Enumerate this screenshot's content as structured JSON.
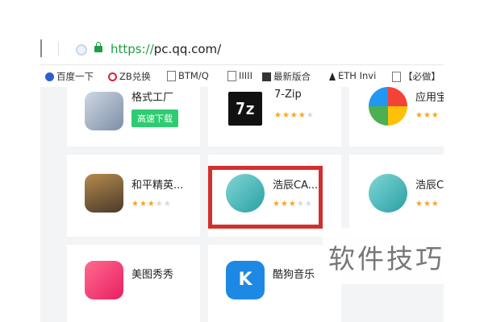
{
  "browser": {
    "separator_glyph": "|",
    "url_prefix": "https://",
    "url_host": "pc.qq.com",
    "url_path": "/"
  },
  "bookmarks": [
    {
      "label": "百度一下",
      "icon": "baidu-paw-icon"
    },
    {
      "label": "ZB兑换",
      "icon": "zb-icon"
    },
    {
      "label": "BTM/Q",
      "icon": "page-icon"
    },
    {
      "label": "IIIII",
      "icon": "page-icon"
    },
    {
      "label": "最新版合",
      "icon": "news-icon"
    },
    {
      "label": "ETH Invi",
      "icon": "eth-icon"
    },
    {
      "label": "【必做】",
      "icon": "page-icon"
    }
  ],
  "apps": {
    "format_factory": {
      "name": "格式工厂",
      "button": "高速下载"
    },
    "seven_zip": {
      "name": "7-Zip",
      "icon_text": "7z",
      "stars": 4
    },
    "app_store": {
      "name": "应用宝",
      "stars": 3
    },
    "peace_elite": {
      "name": "和平精英...",
      "stars": 3
    },
    "haochen_cad_1": {
      "name": "浩辰CA...",
      "stars": 3
    },
    "haochen_cad_2": {
      "name": "浩辰C",
      "stars": 3
    },
    "meitu": {
      "name": "美图秀秀"
    },
    "kugou": {
      "name": "酷狗音乐",
      "icon_text": "K"
    }
  },
  "watermark": "软件技巧",
  "colors": {
    "highlight": "#d32f2f",
    "download_button": "#2ecc71",
    "star": "#f5a623"
  }
}
